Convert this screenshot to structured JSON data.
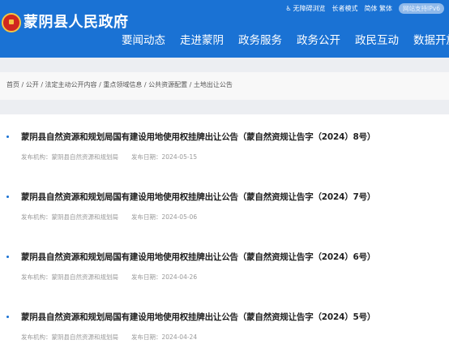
{
  "header": {
    "site_title": "蒙阴县人民政府",
    "utility": {
      "accessibility": "无障碍浏览",
      "elder_mode": "长者模式",
      "simplified": "简体",
      "traditional": "繁体",
      "ipv6": "网站支持IPv6"
    },
    "nav": [
      "要闻动态",
      "走进蒙阴",
      "政务服务",
      "政务公开",
      "政民互动",
      "数据开放"
    ]
  },
  "breadcrumb": "首页 / 公开 / 法定主动公开内容 / 重点领域信息 / 公共资源配置 / 土地出让公告",
  "articles": [
    {
      "title": "蒙阴县自然资源和规划局国有建设用地使用权挂牌出让公告（蒙自然资规让告字（2024）8号）",
      "publisher": "发布机构：蒙阴县自然资源和规划局",
      "date": "发布日期：2024-05-15"
    },
    {
      "title": "蒙阴县自然资源和规划局国有建设用地使用权挂牌出让公告（蒙自然资规让告字（2024）7号）",
      "publisher": "发布机构：蒙阴县自然资源和规划局",
      "date": "发布日期：2024-05-06"
    },
    {
      "title": "蒙阴县自然资源和规划局国有建设用地使用权挂牌出让公告（蒙自然资规让告字（2024）6号）",
      "publisher": "发布机构：蒙阴县自然资源和规划局",
      "date": "发布日期：2024-04-26"
    },
    {
      "title": "蒙阴县自然资源和规划局国有建设用地使用权挂牌出让公告（蒙自然资规让告字（2024）5号）",
      "publisher": "发布机构：蒙阴县自然资源和规划局",
      "date": "发布日期：2024-04-24"
    }
  ],
  "colors": {
    "brand": "#1a72d4",
    "band": "#eceef2"
  }
}
